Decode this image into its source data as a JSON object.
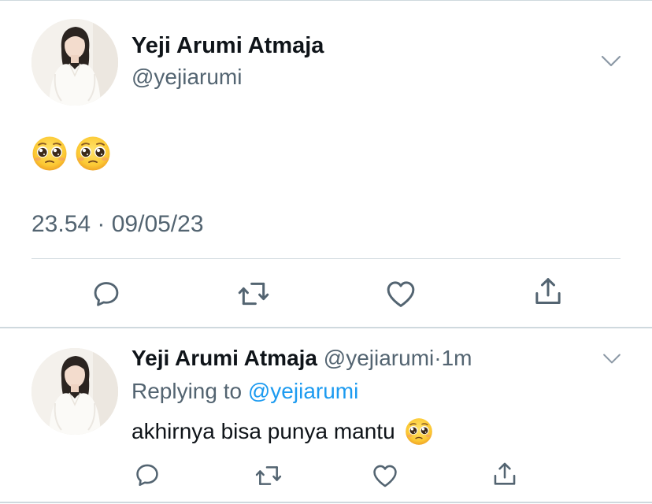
{
  "main_tweet": {
    "author_name": "Yeji Arumi Atmaja",
    "author_handle": "@yejiarumi",
    "content_emoji": [
      "pleading-face-emoji",
      "pleading-face-emoji"
    ],
    "timestamp": "23.54 · 09/05/23",
    "actions": [
      "reply-icon",
      "retweet-icon",
      "like-icon",
      "share-icon"
    ]
  },
  "reply_tweet": {
    "author_name": "Yeji Arumi Atmaja",
    "author_handle": "@yejiarumi",
    "separator": "·",
    "time": "1m",
    "replying_label": "Replying to",
    "replying_handle": "@yejiarumi",
    "text": "akhirnya bisa punya mantu",
    "text_emoji": "pleading-face-emoji",
    "actions": [
      "reply-icon",
      "retweet-icon",
      "like-icon",
      "share-icon"
    ]
  },
  "colors": {
    "primary_text": "#0f1419",
    "secondary_text": "#536471",
    "link": "#1d9bf0",
    "divider": "#cfd9de",
    "icon": "#536471"
  }
}
